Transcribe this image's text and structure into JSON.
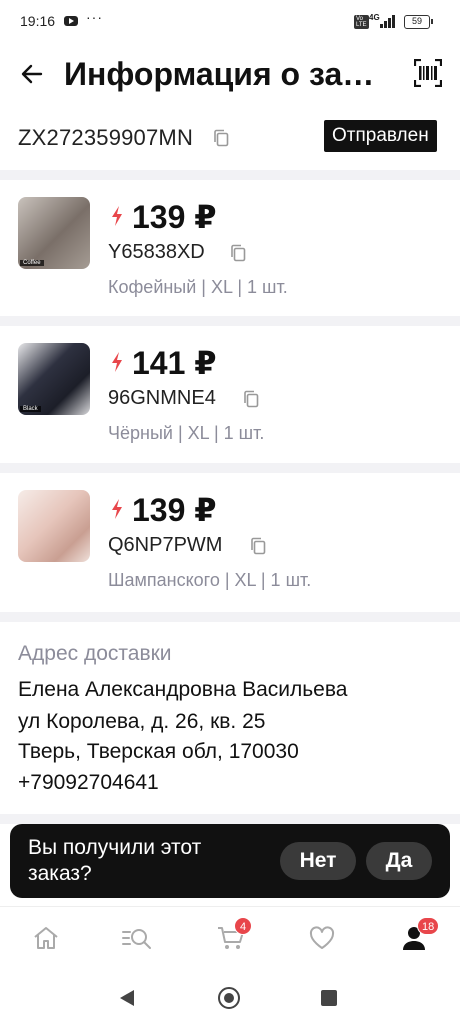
{
  "status_bar": {
    "time": "19:16",
    "network": "4G",
    "volte": "Vo LTE",
    "battery": "59"
  },
  "header": {
    "title": "Информация о заказе",
    "back_icon": "arrow-left-icon",
    "barcode_icon": "barcode-icon"
  },
  "order": {
    "number": "ZX272359907MN",
    "status": "Отправлен"
  },
  "products": [
    {
      "price": "139 ₽",
      "sku": "Y65838XD",
      "variant": "Кофейный | XL | 1 шт.",
      "thumb_label": "Coffee",
      "thumb_color": "#8a7e76"
    },
    {
      "price": "141 ₽",
      "sku": "96GNMNE4",
      "variant": "Чёрный | XL | 1 шт.",
      "thumb_label": "Black",
      "thumb_color": "#2e3140"
    },
    {
      "price": "139 ₽",
      "sku": "Q6NP7PWM",
      "variant": "Шампанского | XL | 1 шт.",
      "thumb_label": "",
      "thumb_color": "#e6c5bb"
    }
  ],
  "address": {
    "label": "Адрес доставки",
    "name": "Елена Александровна Васильева",
    "street": "ул Королева, д. 26, кв. 25",
    "city": "Тверь, Тверская обл, 170030",
    "phone": "+79092704641"
  },
  "confirm": {
    "question": "Вы получили этот заказ?",
    "no_label": "Нет",
    "yes_label": "Да"
  },
  "tab_bar": {
    "cart_badge": "4",
    "profile_badge": "18"
  },
  "colors": {
    "accent_red": "#e8464b",
    "badge_black": "#111111",
    "muted_text": "#8c8c9a"
  }
}
